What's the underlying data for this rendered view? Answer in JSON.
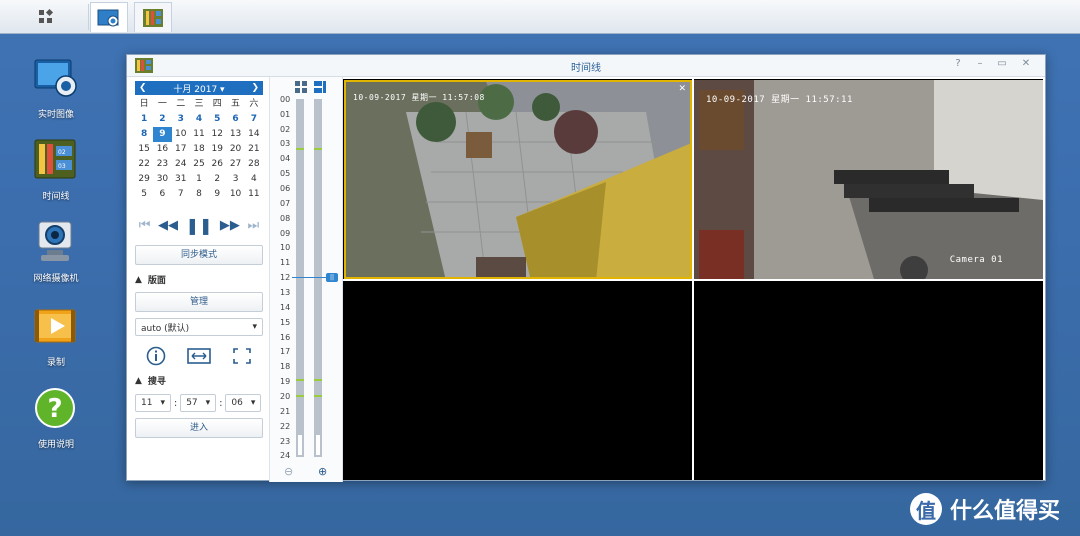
{
  "window": {
    "title": "时间线"
  },
  "desktop": {
    "icons": [
      {
        "label": "实时图像",
        "icon": "live-view-icon"
      },
      {
        "label": "时间线",
        "icon": "timeline-icon"
      },
      {
        "label": "网络摄像机",
        "icon": "ip-camera-icon"
      },
      {
        "label": "录制",
        "icon": "recording-icon"
      },
      {
        "label": "使用说明",
        "icon": "help-icon"
      }
    ]
  },
  "calendar": {
    "month_label": "十月 2017",
    "weekdays": [
      "日",
      "一",
      "二",
      "三",
      "四",
      "五",
      "六"
    ],
    "days": [
      "1",
      "2",
      "3",
      "4",
      "5",
      "6",
      "7",
      "8",
      "9",
      "10",
      "11",
      "12",
      "13",
      "14",
      "15",
      "16",
      "17",
      "18",
      "19",
      "20",
      "21",
      "22",
      "23",
      "24",
      "25",
      "26",
      "27",
      "28",
      "29",
      "30",
      "31",
      "1",
      "2",
      "3",
      "4",
      "5",
      "6",
      "7",
      "8",
      "9",
      "10",
      "11"
    ],
    "selected_day": "9"
  },
  "controls": {
    "sync_mode": "同步模式",
    "layout_section": "版面",
    "manage": "管理",
    "layout_select": "auto (默认)",
    "search_section": "搜寻",
    "hour": "11",
    "minute": "57",
    "second": "06",
    "enter": "进入"
  },
  "ruler": {
    "hours": [
      "00",
      "01",
      "02",
      "03",
      "04",
      "05",
      "06",
      "07",
      "08",
      "09",
      "10",
      "11",
      "12",
      "13",
      "14",
      "15",
      "16",
      "17",
      "18",
      "19",
      "20",
      "21",
      "22",
      "23",
      "24"
    ],
    "current_hour_marker": "12"
  },
  "cameras": [
    {
      "osd_time": "10-09-2017 星期一 11:57:08",
      "label": ""
    },
    {
      "osd_time": "10-09-2017 星期一 11:57:11",
      "label": "Camera 01"
    }
  ],
  "watermark": {
    "text": "什么值得买",
    "glyph": "值"
  },
  "colors": {
    "accent": "#1f6fc0",
    "selected_border": "#e1b400",
    "desktop": "#3c6eae"
  }
}
